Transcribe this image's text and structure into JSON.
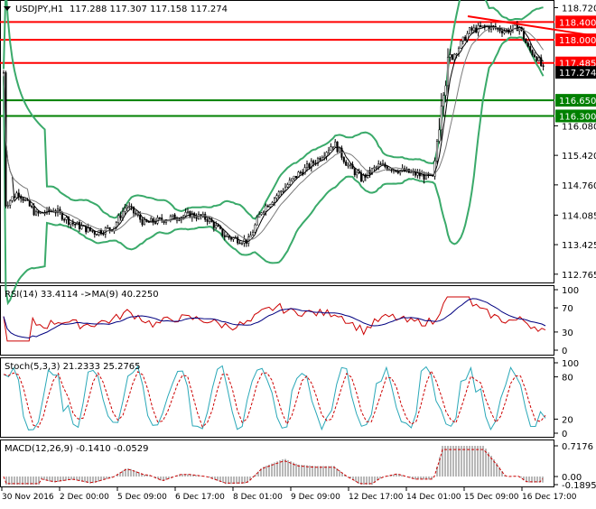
{
  "colors": {
    "background": "#ffffff",
    "border": "#000000",
    "candle": "#000000",
    "bollinger": "#3aaa6a",
    "ma_fast": "#000000",
    "ma_slow": "#7a7a7a",
    "resistance": "#ff0000",
    "support": "#008000",
    "rsi_line": "#000080",
    "rsi_ma": "#cc0000",
    "stoch_main": "#2aa8b8",
    "stoch_signal": "#cc0000",
    "macd_hist": "#b8b8b8",
    "macd_signal": "#cc0000",
    "current_price_bg": "#000000"
  },
  "main": {
    "symbol_label": "USDJPY,H1",
    "ohlc_label": "117.288 117.307 117.158 117.274",
    "menu_icon": "triangle-down-icon",
    "price_scale": [
      "118.720",
      "118.400",
      "118.000",
      "117.485",
      "117.274",
      "116.650",
      "116.300",
      "116.080",
      "115.420",
      "114.760",
      "114.085",
      "113.425",
      "112.765"
    ],
    "levels": [
      {
        "name": "resistance-118400",
        "label": "118.400",
        "value": 118.4,
        "kind": "resistance"
      },
      {
        "name": "resistance-118000",
        "label": "118.000",
        "value": 118.0,
        "kind": "resistance"
      },
      {
        "name": "resistance-117485",
        "label": "117.485",
        "value": 117.485,
        "kind": "resistance"
      },
      {
        "name": "support-116650",
        "label": "116.650",
        "value": 116.65,
        "kind": "support"
      },
      {
        "name": "support-116300",
        "label": "116.300",
        "value": 116.3,
        "kind": "support"
      }
    ],
    "current_price": "117.274",
    "y_range": [
      112.6,
      118.85
    ]
  },
  "rsi": {
    "label": "RSI(14) 33.4114 ->MA(9) 40.2250",
    "scale": [
      "100",
      "70",
      "30",
      "0"
    ]
  },
  "stoch": {
    "label": "Stoch(5,3,3) 21.2333 25.2765",
    "scale": [
      "100",
      "80",
      "20",
      "0"
    ]
  },
  "macd": {
    "label": "MACD(12,26,9) -0.1410 -0.0529",
    "scale": [
      "0.7176",
      "0.00",
      "-0.1895"
    ]
  },
  "time_axis": [
    "30 Nov 2016",
    "2 Dec 00:00",
    "5 Dec 09:00",
    "6 Dec 17:00",
    "8 Dec 01:00",
    "9 Dec 09:00",
    "12 Dec 17:00",
    "14 Dec 01:00",
    "15 Dec 09:00",
    "16 Dec 17:00"
  ],
  "chart_data": {
    "type": "candlestick",
    "description_series": [
      {
        "name": "price",
        "x": [
          "30 Nov 2016",
          "2 Dec 00:00",
          "5 Dec 09:00",
          "6 Dec 17:00",
          "8 Dec 01:00",
          "9 Dec 09:00",
          "12 Dec 17:00",
          "14 Dec 01:00",
          "15 Dec 09:00",
          "16 Dec 17:00"
        ],
        "values": [
          114.4,
          113.9,
          113.8,
          114.0,
          113.6,
          115.4,
          115.0,
          114.9,
          118.2,
          117.27
        ]
      }
    ],
    "rsi_last": 33.4114,
    "rsi_ma_last": 40.225,
    "stoch_main_last": 21.2333,
    "stoch_signal_last": 25.2765,
    "macd_last": -0.141,
    "macd_signal_last": -0.0529
  }
}
